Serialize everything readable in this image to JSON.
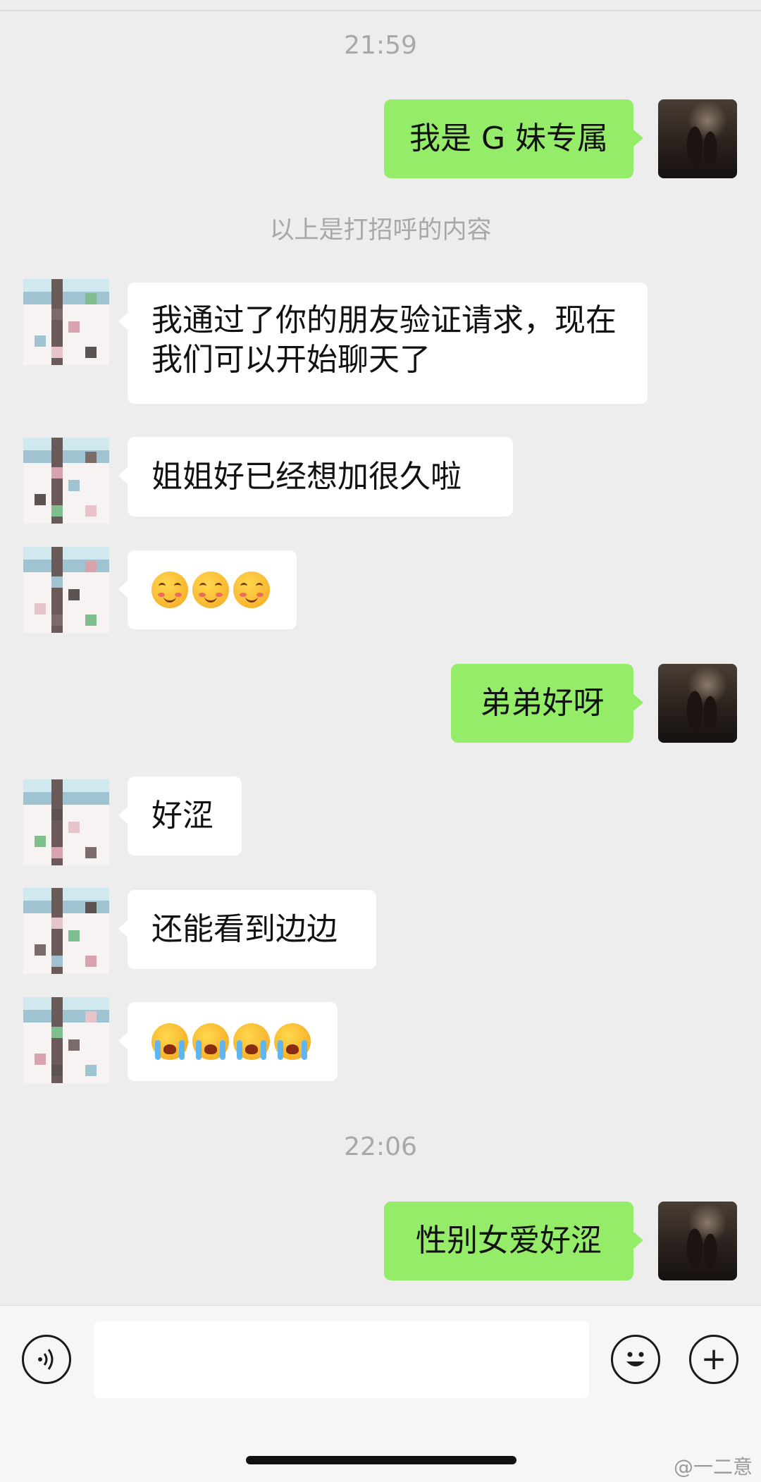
{
  "chat": {
    "time1": "21:59",
    "msg_out_1": "我是 G 妹专属",
    "system_notice": "以上是打招呼的内容",
    "msg_in_1": "我通过了你的朋友验证请求，现在我们可以开始聊天了",
    "msg_in_2": "姐姐好已经想加很久啦",
    "msg_in_3_emoji": [
      "smiling-face-with-blush",
      "smiling-face-with-blush",
      "smiling-face-with-blush"
    ],
    "msg_out_2": "弟弟好呀",
    "msg_in_4": "好涩",
    "msg_in_5": "还能看到边边",
    "msg_in_6_emoji": [
      "loudly-crying-face",
      "loudly-crying-face",
      "loudly-crying-face",
      "loudly-crying-face"
    ],
    "time2": "22:06",
    "msg_out_3": "性别女爱好涩"
  },
  "input_bar": {
    "voice_icon": "voice-icon",
    "emoji_icon": "smiley-icon",
    "add_icon": "plus-icon",
    "add_symbol": "+"
  },
  "watermark": "@一二意",
  "colors": {
    "background": "#ededed",
    "outgoing_bubble": "#95ec69",
    "incoming_bubble": "#ffffff"
  }
}
